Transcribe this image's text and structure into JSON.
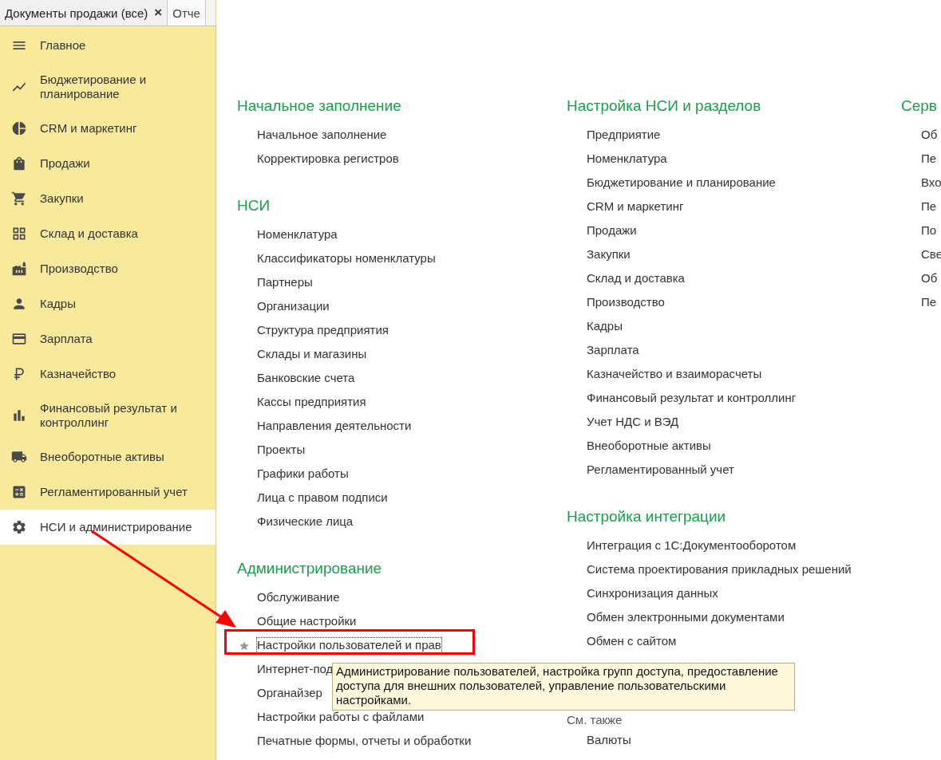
{
  "tabs": [
    {
      "label": "Документы продажи (все)",
      "close": "×",
      "selected": true
    },
    {
      "label": "Отче",
      "selected": false
    }
  ],
  "sidebar": {
    "items": [
      {
        "label": "Главное",
        "selected": false
      },
      {
        "label": "Бюджетирование и планирование",
        "selected": false
      },
      {
        "label": "CRM и маркетинг",
        "selected": false
      },
      {
        "label": "Продажи",
        "selected": false
      },
      {
        "label": "Закупки",
        "selected": false
      },
      {
        "label": "Склад и доставка",
        "selected": false
      },
      {
        "label": "Производство",
        "selected": false
      },
      {
        "label": "Кадры",
        "selected": false
      },
      {
        "label": "Зарплата",
        "selected": false
      },
      {
        "label": "Казначейство",
        "selected": false
      },
      {
        "label": "Финансовый результат и контроллинг",
        "selected": false
      },
      {
        "label": "Внеоборотные активы",
        "selected": false
      },
      {
        "label": "Регламентированный учет",
        "selected": false
      },
      {
        "label": "НСИ и администрирование",
        "selected": true
      }
    ]
  },
  "columns": [
    {
      "sections": [
        {
          "kind": "group",
          "title": "Начальное заполнение",
          "items": [
            {
              "label": "Начальное заполнение",
              "focused": false
            },
            {
              "label": "Корректировка регистров",
              "focused": false
            }
          ]
        },
        {
          "kind": "group",
          "title": "НСИ",
          "items": [
            {
              "label": "Номенклатура",
              "focused": false
            },
            {
              "label": "Классификаторы номенклатуры",
              "focused": false
            },
            {
              "label": "Партнеры",
              "focused": false
            },
            {
              "label": "Организации",
              "focused": false
            },
            {
              "label": "Структура предприятия",
              "focused": false
            },
            {
              "label": "Склады и магазины",
              "focused": false
            },
            {
              "label": "Банковские счета",
              "focused": false
            },
            {
              "label": "Кассы предприятия",
              "focused": false
            },
            {
              "label": "Направления деятельности",
              "focused": false
            },
            {
              "label": "Проекты",
              "focused": false
            },
            {
              "label": "Графики работы",
              "focused": false
            },
            {
              "label": "Лица с правом подписи",
              "focused": false
            },
            {
              "label": "Физические лица",
              "focused": false
            }
          ]
        },
        {
          "kind": "group",
          "title": "Администрирование",
          "items": [
            {
              "label": "Обслуживание",
              "focused": false
            },
            {
              "label": "Общие настройки",
              "focused": false
            },
            {
              "label": "Настройки пользователей и прав",
              "focused": true
            },
            {
              "label": "Интернет-под",
              "focused": false
            },
            {
              "label": "Органайзер",
              "focused": false
            },
            {
              "label": "Настройки работы с файлами",
              "focused": false
            },
            {
              "label": "Печатные формы, отчеты и обработки",
              "focused": false
            }
          ]
        }
      ]
    },
    {
      "sections": [
        {
          "kind": "group",
          "title": "Настройка НСИ и разделов",
          "items": [
            {
              "label": "Предприятие",
              "focused": false
            },
            {
              "label": "Номенклатура",
              "focused": false
            },
            {
              "label": "Бюджетирование и планирование",
              "focused": false
            },
            {
              "label": "CRM и маркетинг",
              "focused": false
            },
            {
              "label": "Продажи",
              "focused": false
            },
            {
              "label": "Закупки",
              "focused": false
            },
            {
              "label": "Склад и доставка",
              "focused": false
            },
            {
              "label": "Производство",
              "focused": false
            },
            {
              "label": "Кадры",
              "focused": false
            },
            {
              "label": "Зарплата",
              "focused": false
            },
            {
              "label": "Казначейство и взаиморасчеты",
              "focused": false
            },
            {
              "label": "Финансовый результат и контроллинг",
              "focused": false
            },
            {
              "label": "Учет НДС и ВЭД",
              "focused": false
            },
            {
              "label": "Внеоборотные активы",
              "focused": false
            },
            {
              "label": "Регламентированный учет",
              "focused": false
            }
          ]
        },
        {
          "kind": "group",
          "title": "Настройка интеграции",
          "items": [
            {
              "label": "Интеграция с 1С:Документооборотом",
              "focused": false
            },
            {
              "label": "Система проектирования прикладных решений",
              "focused": false
            },
            {
              "label": "Синхронизация данных",
              "focused": false
            },
            {
              "label": "Обмен электронными документами",
              "focused": false
            },
            {
              "label": "Обмен с сайтом",
              "focused": false
            }
          ]
        },
        {
          "kind": "see_also",
          "title": "См. также",
          "items": [
            {
              "label": "Валюты",
              "focused": false
            }
          ]
        }
      ]
    },
    {
      "sections": [
        {
          "kind": "group",
          "title": "Серв",
          "items": [
            {
              "label": "Об",
              "focused": false
            },
            {
              "label": "Пе",
              "focused": false
            },
            {
              "label": "Вхо",
              "focused": false
            },
            {
              "label": "Пе",
              "focused": false
            },
            {
              "label": "По",
              "focused": false
            },
            {
              "label": "Све",
              "focused": false
            },
            {
              "label": "Об",
              "focused": false
            },
            {
              "label": "Пе",
              "focused": false
            }
          ]
        }
      ]
    }
  ],
  "tooltip": {
    "text": "Администрирование пользователей, настройка групп доступа, предоставление доступа для внешних пользователей, управление пользовательскими настройками."
  }
}
